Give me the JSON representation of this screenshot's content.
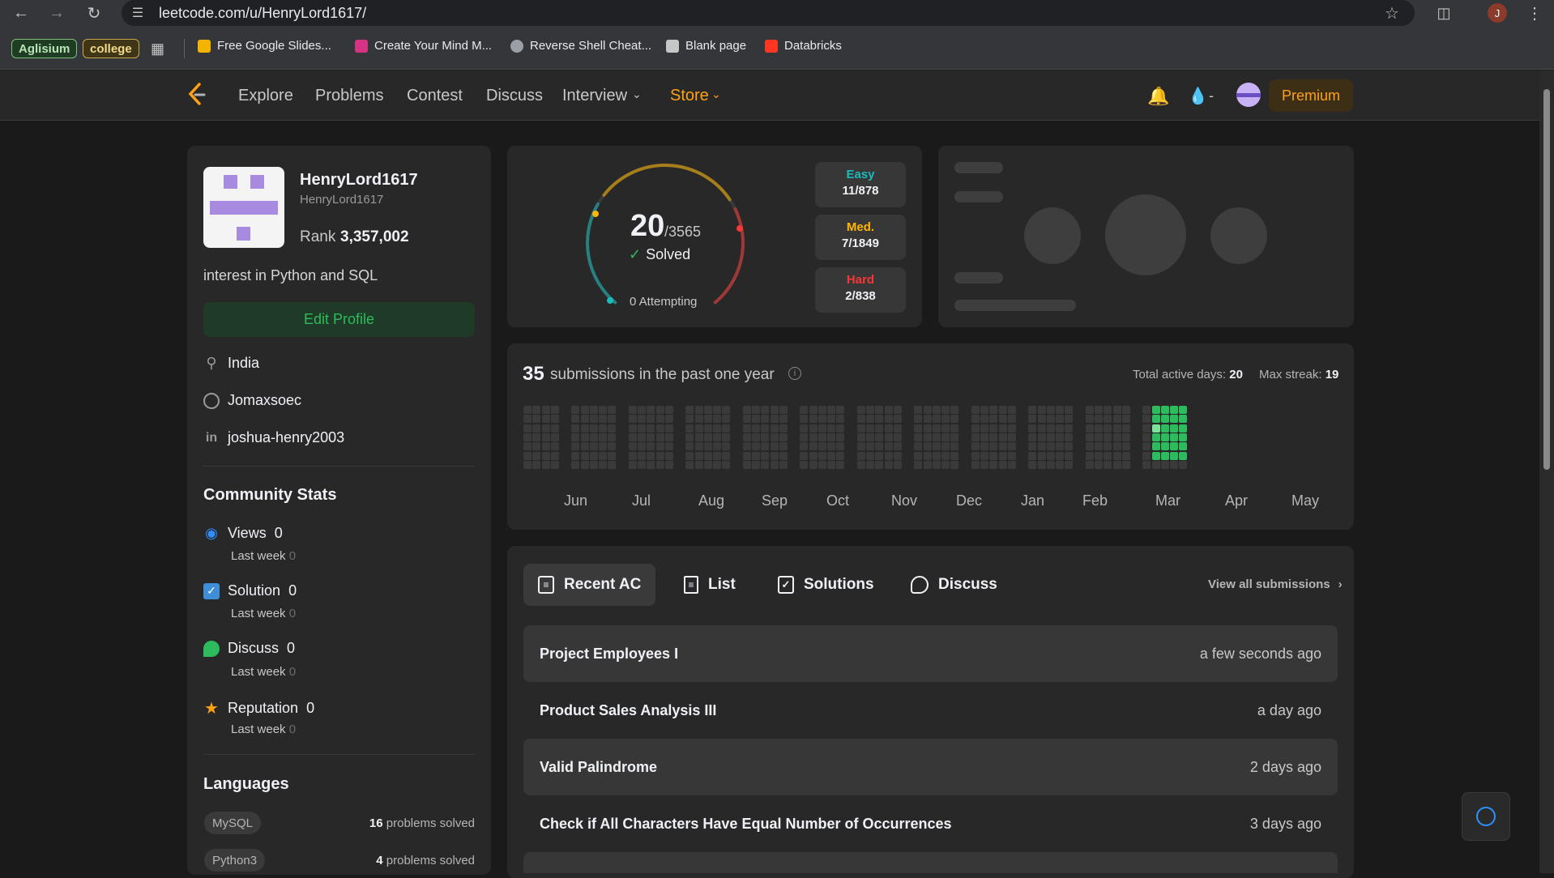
{
  "browser": {
    "url": "leetcode.com/u/HenryLord1617/",
    "profile_initial": "J"
  },
  "bookmarks": {
    "chips": [
      "Aglisium",
      "college"
    ],
    "items": [
      "Free Google Slides...",
      "Create Your Mind M...",
      "Reverse Shell Cheat...",
      "Blank page",
      "Databricks"
    ]
  },
  "nav": {
    "links": [
      "Explore",
      "Problems",
      "Contest",
      "Discuss",
      "Interview",
      "Store"
    ],
    "streak": "-",
    "premium": "Premium"
  },
  "profile": {
    "name": "HenryLord1617",
    "username": "HenryLord1617",
    "rank_label": "Rank",
    "rank": "3,357,002",
    "bio": "interest in Python and SQL",
    "edit_button": "Edit Profile",
    "location": "India",
    "github": "Jomaxsoec",
    "linkedin": "joshua-henry2003"
  },
  "community": {
    "title": "Community Stats",
    "last_week_label": "Last week",
    "items": [
      {
        "label": "Views",
        "value": "0",
        "last_week": "0"
      },
      {
        "label": "Solution",
        "value": "0",
        "last_week": "0"
      },
      {
        "label": "Discuss",
        "value": "0",
        "last_week": "0"
      },
      {
        "label": "Reputation",
        "value": "0",
        "last_week": "0"
      }
    ]
  },
  "languages": {
    "title": "Languages",
    "items": [
      {
        "name": "MySQL",
        "count": "16",
        "suffix": "problems solved"
      },
      {
        "name": "Python3",
        "count": "4",
        "suffix": "problems solved"
      }
    ]
  },
  "progress": {
    "solved": "20",
    "total": "/3565",
    "solved_label": "Solved",
    "attempting": "0 Attempting",
    "easy_label": "Easy",
    "easy": "11/878",
    "med_label": "Med.",
    "med": "7/1849",
    "hard_label": "Hard",
    "hard": "2/838",
    "colors": {
      "easy": "#1cbaba",
      "med": "#ffb700",
      "hard": "#f63737"
    }
  },
  "calendar": {
    "count": "35",
    "title": "submissions in the past one year",
    "active_label": "Total active days:",
    "active": "20",
    "streak_label": "Max streak:",
    "streak": "19",
    "months": [
      "Jun",
      "Jul",
      "Aug",
      "Sep",
      "Oct",
      "Nov",
      "Dec",
      "Jan",
      "Feb",
      "Mar",
      "Apr",
      "May"
    ]
  },
  "recent": {
    "tabs": [
      "Recent AC",
      "List",
      "Solutions",
      "Discuss"
    ],
    "view_all": "View all submissions",
    "rows": [
      {
        "title": "Project Employees I",
        "time": "a few seconds ago"
      },
      {
        "title": "Product Sales Analysis III",
        "time": "a day ago"
      },
      {
        "title": "Valid Palindrome",
        "time": "2 days ago"
      },
      {
        "title": "Check if All Characters Have Equal Number of Occurrences",
        "time": "3 days ago"
      }
    ]
  }
}
